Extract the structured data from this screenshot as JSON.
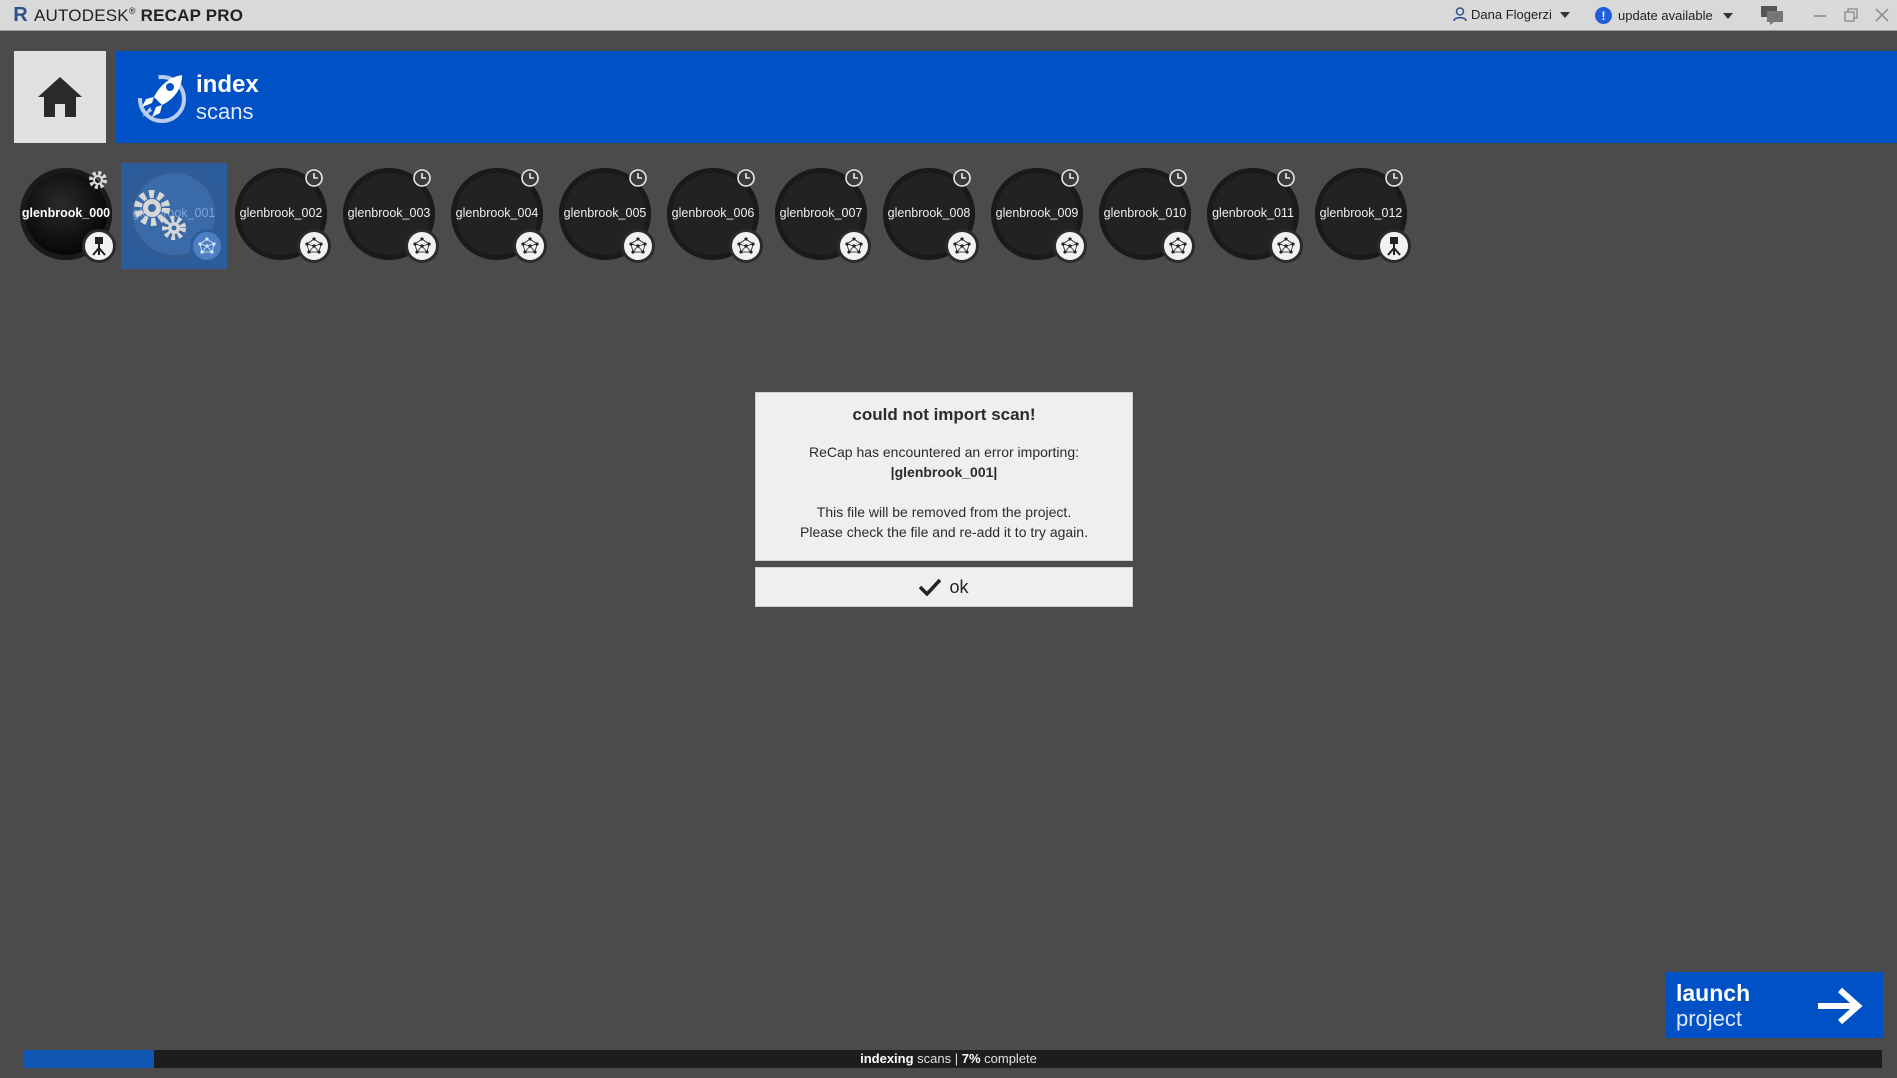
{
  "titlebar": {
    "logo_letter": "R",
    "brand": "AUTODESK",
    "product": "RECAP PRO",
    "user_name": "Dana Flogerzi",
    "update_icon": "!",
    "update_text": "update available"
  },
  "header": {
    "title": "index",
    "subtitle": "scans"
  },
  "scans": [
    {
      "name": "glenbrook_000",
      "status": "processing",
      "type": "tripod"
    },
    {
      "name": "glenbrook_001",
      "status": "selected-processing",
      "type": "pointcloud"
    },
    {
      "name": "glenbrook_002",
      "status": "pending",
      "type": "pointcloud"
    },
    {
      "name": "glenbrook_003",
      "status": "pending",
      "type": "pointcloud"
    },
    {
      "name": "glenbrook_004",
      "status": "pending",
      "type": "pointcloud"
    },
    {
      "name": "glenbrook_005",
      "status": "pending",
      "type": "pointcloud"
    },
    {
      "name": "glenbrook_006",
      "status": "pending",
      "type": "pointcloud"
    },
    {
      "name": "glenbrook_007",
      "status": "pending",
      "type": "pointcloud"
    },
    {
      "name": "glenbrook_008",
      "status": "pending",
      "type": "pointcloud"
    },
    {
      "name": "glenbrook_009",
      "status": "pending",
      "type": "pointcloud"
    },
    {
      "name": "glenbrook_010",
      "status": "pending",
      "type": "pointcloud"
    },
    {
      "name": "glenbrook_011",
      "status": "pending",
      "type": "pointcloud"
    },
    {
      "name": "glenbrook_012",
      "status": "pending",
      "type": "tripod"
    }
  ],
  "dialog": {
    "title": "could not import scan!",
    "message_line1": "ReCap has encountered an error importing:",
    "filename": "|glenbrook_001|",
    "message_line2": "This file will be removed from the project.",
    "message_line3": "Please check the file and re-add it to try again.",
    "ok_label": "ok"
  },
  "launch": {
    "line1": "launch",
    "line2": "project"
  },
  "progress": {
    "label_bold": "indexing",
    "label_rest": " scans | ",
    "percent_text": "7%",
    "suffix": " complete",
    "fraction": 0.07
  },
  "colors": {
    "accent": "#0051c6",
    "background": "#4b4b4b",
    "progress_fill": "#0f56b3"
  }
}
